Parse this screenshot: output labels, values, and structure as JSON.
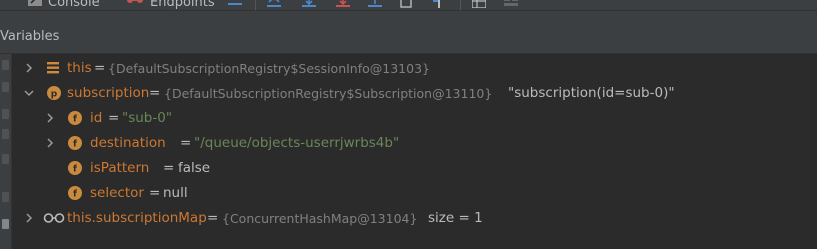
{
  "toolbar": {
    "console_tab": "Console",
    "endpoints_tab": "Endpoints"
  },
  "panel": {
    "title": "Variables"
  },
  "tree": {
    "rows": [
      {
        "name": "this",
        "equals": "=",
        "ref": "{DefaultSubscriptionRegistry$SessionInfo@13103}",
        "value": "",
        "icon": "field-list-icon",
        "expanded": false
      },
      {
        "name": "subscription",
        "equals": "=",
        "ref": "{DefaultSubscriptionRegistry$Subscription@13110}",
        "value": "\"subscription(id=sub-0)\"",
        "icon": "parameter-icon",
        "expanded": true
      },
      {
        "name": "id",
        "equals": "=",
        "ref": "",
        "value": "\"sub-0\"",
        "icon": "field-icon",
        "expanded": false
      },
      {
        "name": "destination",
        "equals": "=",
        "ref": "",
        "value": "\"/queue/objects-userrjwrbs4b\"",
        "icon": "field-icon",
        "expanded": false
      },
      {
        "name": "isPattern",
        "equals": "=",
        "ref": "",
        "value": "false",
        "icon": "field-icon",
        "expanded": null
      },
      {
        "name": "selector",
        "equals": "=",
        "ref": "",
        "value": "null",
        "icon": "field-icon",
        "expanded": null
      },
      {
        "name": "this.subscriptionMap",
        "equals": "=",
        "ref": "{ConcurrentHashMap@13104}",
        "value": "size = 1",
        "icon": "watch-glasses-icon",
        "expanded": false
      }
    ]
  },
  "colors": {
    "background": "#2b2b2b",
    "panel": "#3c3f41",
    "name": "#cc7832",
    "string": "#6a8759",
    "reference": "#808080",
    "text": "#bbbbbb"
  }
}
